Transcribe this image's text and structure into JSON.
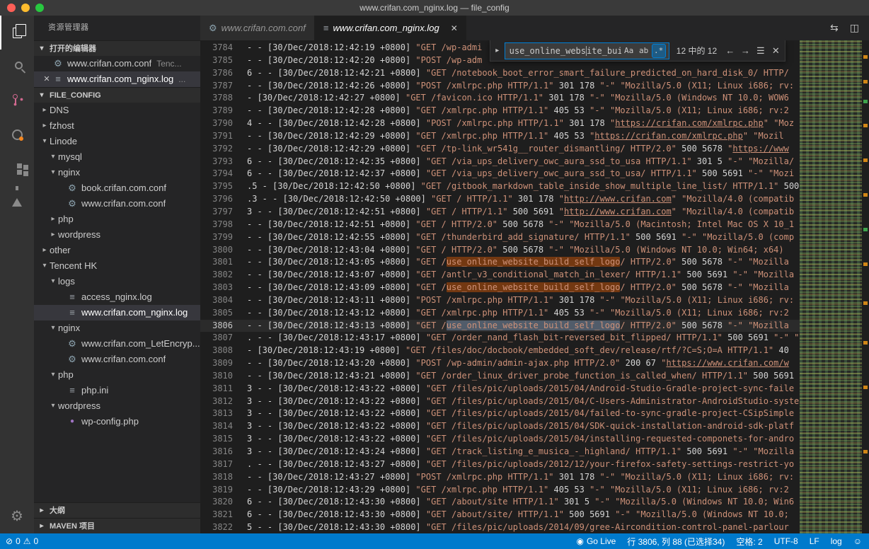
{
  "colors": {
    "accent": "#007acc",
    "statusbar_bg": "#007acc",
    "editor_bg": "#1e1e1e",
    "string_color": "#ce9178",
    "find_match_bg": "#613a14",
    "current_match_bg": "#515c6a",
    "traffic_close": "#ff5f57",
    "traffic_minimize": "#febc2e",
    "traffic_maximize": "#28c840"
  },
  "titlebar": {
    "title": "www.crifan.com_nginx.log — file_config"
  },
  "activity_bar": {
    "items": [
      {
        "name": "explorer",
        "active": true
      },
      {
        "name": "search",
        "active": false
      },
      {
        "name": "source-control",
        "active": false
      },
      {
        "name": "run-circle",
        "active": false
      },
      {
        "name": "extensions",
        "active": false
      },
      {
        "name": "test",
        "active": false
      }
    ],
    "bottom": [
      {
        "name": "settings"
      }
    ]
  },
  "sidebar": {
    "title": "资源管理器",
    "sections": {
      "open_editors": "打开的编辑器",
      "folder": "FILE_CONFIG",
      "outline": "大纲",
      "maven": "MAVEN 项目"
    },
    "open_editors": [
      {
        "label": "www.crifan.com.conf",
        "detail": "Tenc...",
        "icon": "gear",
        "selected": false,
        "closable": false
      },
      {
        "label": "www.crifan.com_nginx.log",
        "detail": "...",
        "icon": "log",
        "selected": true,
        "closable": true
      }
    ],
    "tree": [
      {
        "label": "DNS",
        "arrow": "collapsed",
        "depth": 0
      },
      {
        "label": "fzhost",
        "arrow": "collapsed",
        "depth": 0
      },
      {
        "label": "Linode",
        "arrow": "expanded",
        "depth": 0
      },
      {
        "label": "mysql",
        "arrow": "expanded",
        "depth": 1
      },
      {
        "label": "nginx",
        "arrow": "expanded",
        "depth": 1
      },
      {
        "label": "book.crifan.com.conf",
        "icon": "gear",
        "depth": 2
      },
      {
        "label": "www.crifan.com.conf",
        "icon": "gear",
        "depth": 2
      },
      {
        "label": "php",
        "arrow": "collapsed",
        "depth": 1
      },
      {
        "label": "wordpress",
        "arrow": "collapsed",
        "depth": 1
      },
      {
        "label": "other",
        "arrow": "collapsed",
        "depth": 0
      },
      {
        "label": "Tencent HK",
        "arrow": "expanded",
        "depth": 0
      },
      {
        "label": "logs",
        "arrow": "expanded",
        "depth": 1
      },
      {
        "label": "access_nginx.log",
        "icon": "log",
        "depth": 2
      },
      {
        "label": "www.crifan.com_nginx.log",
        "icon": "log",
        "depth": 2,
        "selected": true
      },
      {
        "label": "nginx",
        "arrow": "expanded",
        "depth": 1
      },
      {
        "label": "www.crifan.com_LetEncryp...",
        "icon": "gear",
        "depth": 2
      },
      {
        "label": "www.crifan.com.conf",
        "icon": "gear",
        "depth": 2
      },
      {
        "label": "php",
        "arrow": "expanded",
        "depth": 1
      },
      {
        "label": "php.ini",
        "icon": "log",
        "depth": 2
      },
      {
        "label": "wordpress",
        "arrow": "expanded",
        "depth": 1
      },
      {
        "label": "wp-config.php",
        "icon": "php",
        "depth": 2
      }
    ]
  },
  "editor": {
    "tabs": [
      {
        "label": "www.crifan.com.conf",
        "icon": "gear",
        "active": false
      },
      {
        "label": "www.crifan.com_nginx.log",
        "icon": "log",
        "active": true
      }
    ],
    "find": {
      "query": "use_online_website_build",
      "query_before_caret": "use_online_webs",
      "query_after_caret": "ite_build",
      "match_case_label": "Aa",
      "whole_word_label": "ab",
      "regex_label": ".*",
      "regex_active": true,
      "results": "12 中的 12",
      "term_highlight": "use_online_website_build_self_logo"
    },
    "current_line": 3806,
    "lines": [
      {
        "n": 3784,
        "t": "- - [30/Dec/2018:12:42:19 +0800] \"GET /wp-admi"
      },
      {
        "n": 3785,
        "t": "- - [30/Dec/2018:12:42:20 +0800] \"POST /wp-adm"
      },
      {
        "n": 3786,
        "t": "6 - - [30/Dec/2018:12:42:21 +0800] \"GET /notebook_boot_error_smart_failure_predicted_on_hard_disk_0/ HTTP/"
      },
      {
        "n": 3787,
        "t": "- - [30/Dec/2018:12:42:26 +0800] \"POST /xmlrpc.php HTTP/1.1\" 301 178 \"-\" \"Mozilla/5.0 (X11; Linux i686; rv:"
      },
      {
        "n": 3788,
        "t": "- [30/Dec/2018:12:42:27 +0800] \"GET /favicon.ico HTTP/1.1\" 301 178 \"-\" \"Mozilla/5.0 (Windows NT 10.0; WOW6"
      },
      {
        "n": 3789,
        "t": "- - [30/Dec/2018:12:42:28 +0800] \"GET /xmlrpc.php HTTP/1.1\" 405 53 \"-\" \"Mozilla/5.0 (X11; Linux i686; rv:2"
      },
      {
        "n": 3790,
        "t": "4 - - [30/Dec/2018:12:42:28 +0800] \"POST /xmlrpc.php HTTP/1.1\" 301 178 \"https://crifan.com/xmlrpc.php\" \"Moz"
      },
      {
        "n": 3791,
        "t": "- - [30/Dec/2018:12:42:29 +0800] \"GET /xmlrpc.php HTTP/1.1\" 405 53 \"https://crifan.com/xmlrpc.php\" \"Mozil"
      },
      {
        "n": 3792,
        "t": "- - [30/Dec/2018:12:42:29 +0800] \"GET /tp-link_wr541g__router_dismantling/ HTTP/2.0\" 500 5678 \"https://www"
      },
      {
        "n": 3793,
        "t": "6 - - [30/Dec/2018:12:42:35 +0800] \"GET /via_ups_delivery_owc_aura_ssd_to_usa HTTP/1.1\" 301 5 \"-\" \"Mozilla/"
      },
      {
        "n": 3794,
        "t": "6 - - [30/Dec/2018:12:42:37 +0800] \"GET /via_ups_delivery_owc_aura_ssd_to_usa/ HTTP/1.1\" 500 5691 \"-\" \"Mozi"
      },
      {
        "n": 3795,
        "t": ".5 - [30/Dec/2018:12:42:50 +0800] \"GET /gitbook_markdown_table_inside_show_multiple_line_list/ HTTP/1.1\" 500"
      },
      {
        "n": 3796,
        "t": ".3 - - [30/Dec/2018:12:42:50 +0800] \"GET / HTTP/1.1\" 301 178 \"http://www.crifan.com\" \"Mozilla/4.0 (compatib"
      },
      {
        "n": 3797,
        "t": "3 - - [30/Dec/2018:12:42:51 +0800] \"GET / HTTP/1.1\" 500 5691 \"http://www.crifan.com\" \"Mozilla/4.0 (compatib"
      },
      {
        "n": 3798,
        "t": "- - [30/Dec/2018:12:42:51 +0800] \"GET / HTTP/2.0\" 500 5678 \"-\" \"Mozilla/5.0 (Macintosh; Intel Mac OS X 10_1"
      },
      {
        "n": 3799,
        "t": "- - [30/Dec/2018:12:42:55 +0800] \"GET /thunderbird_add_signature/ HTTP/1.1\" 500 5691 \"-\" \"Mozilla/5.0 (comp"
      },
      {
        "n": 3800,
        "t": "- - [30/Dec/2018:12:43:04 +0800] \"GET / HTTP/2.0\" 500 5678 \"-\" \"Mozilla/5.0 (Windows NT 10.0; Win64; x64)"
      },
      {
        "n": 3801,
        "t": "- - [30/Dec/2018:12:43:05 +0800] \"GET /use_online_website_build_self_logo/ HTTP/2.0\" 500 5678 \"-\" \"Mozilla"
      },
      {
        "n": 3802,
        "t": "- - [30/Dec/2018:12:43:07 +0800] \"GET /antlr_v3_conditional_match_in_lexer/ HTTP/1.1\" 500 5691 \"-\" \"Mozilla"
      },
      {
        "n": 3803,
        "t": "- - [30/Dec/2018:12:43:09 +0800] \"GET /use_online_website_build_self_logo/ HTTP/2.0\" 500 5678 \"-\" \"Mozilla"
      },
      {
        "n": 3804,
        "t": "- - [30/Dec/2018:12:43:11 +0800] \"POST /xmlrpc.php HTTP/1.1\" 301 178 \"-\" \"Mozilla/5.0 (X11; Linux i686; rv:"
      },
      {
        "n": 3805,
        "t": "- - [30/Dec/2018:12:43:12 +0800] \"GET /xmlrpc.php HTTP/1.1\" 405 53 \"-\" \"Mozilla/5.0 (X11; Linux i686; rv:2"
      },
      {
        "n": 3806,
        "t": "- - [30/Dec/2018:12:43:13 +0800] \"GET /use_online_website_build_self_logo/ HTTP/2.0\" 500 5678 \"-\" \"Mozilla"
      },
      {
        "n": 3807,
        "t": ". - - [30/Dec/2018:12:43:17 +0800] \"GET /order_nand_flash_bit-reversed_bit_flipped/ HTTP/1.1\" 500 5691 \"-\" \""
      },
      {
        "n": 3808,
        "t": "- [30/Dec/2018:12:43:19 +0800] \"GET /files/doc/docbook/embedded_soft_dev/release/rtf/?C=S;O=A HTTP/1.1\" 40"
      },
      {
        "n": 3809,
        "t": "- - [30/Dec/2018:12:43:20 +0800] \"POST /wp-admin/admin-ajax.php HTTP/2.0\" 200 67 \"https://www.crifan.com/w"
      },
      {
        "n": 3810,
        "t": "- - [30/Dec/2018:12:43:21 +0800] \"GET /order_linux_driver_probe_function_is_called_when/ HTTP/1.1\" 500 5691"
      },
      {
        "n": 3811,
        "t": "3 - - [30/Dec/2018:12:43:22 +0800] \"GET /files/pic/uploads/2015/04/Android-Studio-Gradle-project-sync-faile"
      },
      {
        "n": 3812,
        "t": "3 - - [30/Dec/2018:12:43:22 +0800] \"GET /files/pic/uploads/2015/04/C-Users-Administrator-AndroidStudio-syste"
      },
      {
        "n": 3813,
        "t": "3 - - [30/Dec/2018:12:43:22 +0800] \"GET /files/pic/uploads/2015/04/failed-to-sync-gradle-project-CSipSimple"
      },
      {
        "n": 3814,
        "t": "3 - - [30/Dec/2018:12:43:22 +0800] \"GET /files/pic/uploads/2015/04/SDK-quick-installation-android-sdk-platf"
      },
      {
        "n": 3815,
        "t": "3 - - [30/Dec/2018:12:43:22 +0800] \"GET /files/pic/uploads/2015/04/installing-requested-componets-for-andro"
      },
      {
        "n": 3816,
        "t": "3 - - [30/Dec/2018:12:43:24 +0800] \"GET /track_listing_e_musica_-_highland/ HTTP/1.1\" 500 5691 \"-\" \"Mozilla"
      },
      {
        "n": 3817,
        "t": ". - - [30/Dec/2018:12:43:27 +0800] \"GET /files/pic/uploads/2012/12/your-firefox-safety-settings-restrict-yo"
      },
      {
        "n": 3818,
        "t": "- - [30/Dec/2018:12:43:27 +0800] \"POST /xmlrpc.php HTTP/1.1\" 301 178 \"-\" \"Mozilla/5.0 (X11; Linux i686; rv:"
      },
      {
        "n": 3819,
        "t": "- - [30/Dec/2018:12:43:29 +0800] \"GET /xmlrpc.php HTTP/1.1\" 405 53 \"-\" \"Mozilla/5.0 (X11; Linux i686; rv:2"
      },
      {
        "n": 3820,
        "t": "6 - - [30/Dec/2018:12:43:30 +0800] \"GET /about/site HTTP/1.1\" 301 5 \"-\" \"Mozilla/5.0 (Windows NT 10.0; Win6"
      },
      {
        "n": 3821,
        "t": "6 - - [30/Dec/2018:12:43:30 +0800] \"GET /about/site/ HTTP/1.1\" 500 5691 \"-\" \"Mozilla/5.0 (Windows NT 10.0; "
      },
      {
        "n": 3822,
        "t": "5 - - [30/Dec/2018:12:43:30 +0800] \"GET /files/pic/uploads/2014/09/gree-Aircondition-control-panel-parlour"
      }
    ]
  },
  "status_bar": {
    "errors": "0",
    "warnings": "0",
    "go_live": "Go Live",
    "cursor": "行 3806, 列 88 (已选择34)",
    "indent": "空格: 2",
    "encoding": "UTF-8",
    "eol": "LF",
    "language": "log"
  }
}
